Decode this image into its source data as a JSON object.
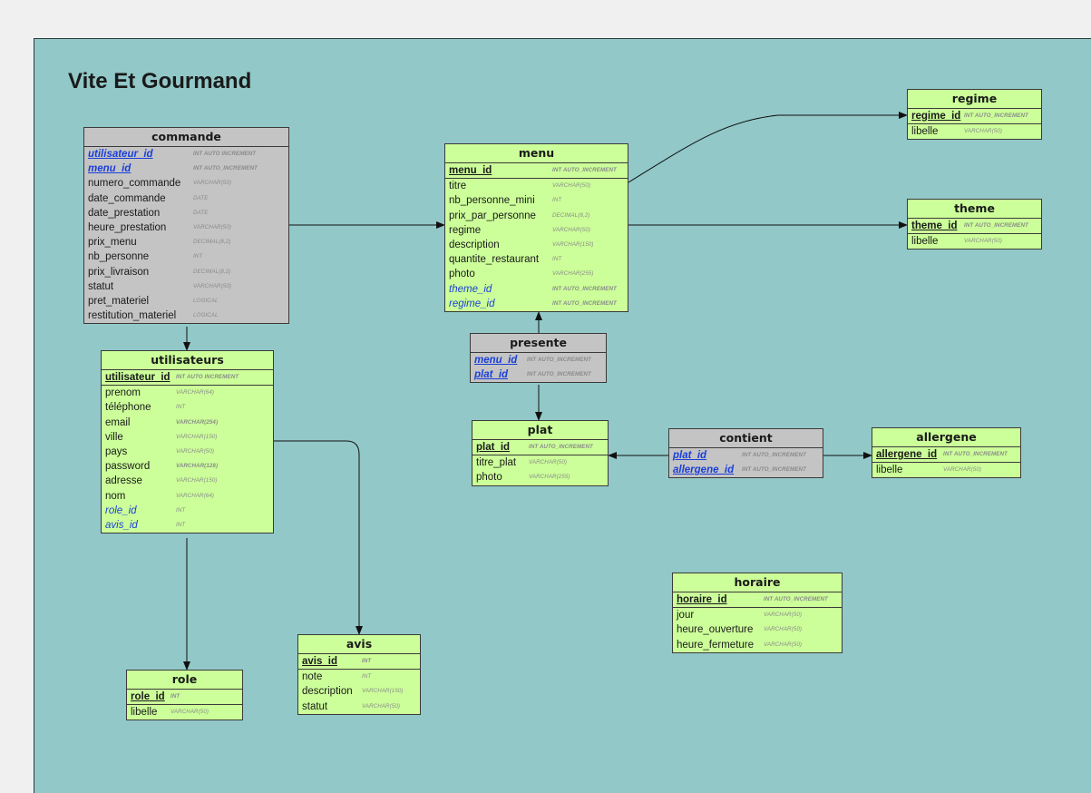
{
  "diagram": {
    "title": "Vite Et Gourmand",
    "colors": {
      "entity": "#ccff99",
      "association": "#c4c4c4",
      "background": "#92c8c8",
      "foreign_key": "#1a3fd9"
    },
    "entities": [
      {
        "id": "commande",
        "name": "commande",
        "style": "gray",
        "fields": [
          {
            "name": "utilisateur_id",
            "type": "INT AUTO INCREMENT",
            "key": "pkfk"
          },
          {
            "name": "menu_id",
            "type": "INT AUTO_INCREMENT",
            "key": "pkfk"
          },
          {
            "name": "numero_commande",
            "type": "VARCHAR(50)",
            "key": ""
          },
          {
            "name": "date_commande",
            "type": "DATE",
            "key": ""
          },
          {
            "name": "date_prestation",
            "type": "DATE",
            "key": ""
          },
          {
            "name": "heure_prestation",
            "type": "VARCHAR(50)",
            "key": ""
          },
          {
            "name": "prix_menu",
            "type": "DECIMAL(8,2)",
            "key": ""
          },
          {
            "name": "nb_personne",
            "type": "INT",
            "key": ""
          },
          {
            "name": "prix_livraison",
            "type": "DECIMAL(8,2)",
            "key": ""
          },
          {
            "name": "statut",
            "type": "VARCHAR(50)",
            "key": ""
          },
          {
            "name": "pret_materiel",
            "type": "LOGICAL",
            "key": ""
          },
          {
            "name": "restitution_materiel",
            "type": "LOGICAL",
            "key": ""
          }
        ]
      },
      {
        "id": "utilisateurs",
        "name": "utilisateurs",
        "style": "green",
        "fields": [
          {
            "name": "utilisateur_id",
            "type": "INT AUTO INCREMENT",
            "key": "pk"
          },
          {
            "name": "prenom",
            "type": "VARCHAR(64)",
            "key": ""
          },
          {
            "name": "téléphone",
            "type": "INT",
            "key": ""
          },
          {
            "name": "email",
            "type": "VARCHAR(254)",
            "key": "",
            "strong": true
          },
          {
            "name": "ville",
            "type": "VARCHAR(150)",
            "key": ""
          },
          {
            "name": "pays",
            "type": "VARCHAR(50)",
            "key": ""
          },
          {
            "name": "password",
            "type": "VARCHAR(128)",
            "key": "",
            "strong": true
          },
          {
            "name": "adresse",
            "type": "VARCHAR(150)",
            "key": ""
          },
          {
            "name": "nom",
            "type": "VARCHAR(64)",
            "key": ""
          },
          {
            "name": "role_id",
            "type": "INT",
            "key": "fk"
          },
          {
            "name": "avis_id",
            "type": "INT",
            "key": "fk"
          }
        ]
      },
      {
        "id": "menu",
        "name": "menu",
        "style": "green",
        "fields": [
          {
            "name": "menu_id",
            "type": "INT AUTO_INCREMENT",
            "key": "pk"
          },
          {
            "name": "titre",
            "type": "VARCHAR(50)",
            "key": ""
          },
          {
            "name": "nb_personne_mini",
            "type": "INT",
            "key": ""
          },
          {
            "name": "prix_par_personne",
            "type": "DECIMAL(8,2)",
            "key": ""
          },
          {
            "name": "regime",
            "type": "VARCHAR(50)",
            "key": ""
          },
          {
            "name": "description",
            "type": "VARCHAR(150)",
            "key": ""
          },
          {
            "name": "quantite_restaurant",
            "type": "INT",
            "key": ""
          },
          {
            "name": "photo",
            "type": "VARCHAR(255)",
            "key": ""
          },
          {
            "name": "theme_id",
            "type": "INT AUTO_INCREMENT",
            "key": "fk",
            "strong": true
          },
          {
            "name": "regime_id",
            "type": "INT AUTO_INCREMENT",
            "key": "fk",
            "strong": true
          }
        ]
      },
      {
        "id": "presente",
        "name": "presente",
        "style": "gray",
        "fields": [
          {
            "name": "menu_id",
            "type": "INT AUTO_INCREMENT",
            "key": "pkfk"
          },
          {
            "name": "plat_id",
            "type": "INT AUTO_INCREMENT",
            "key": "pkfk"
          }
        ]
      },
      {
        "id": "plat",
        "name": "plat",
        "style": "green",
        "fields": [
          {
            "name": "plat_id",
            "type": "INT AUTO_INCREMENT",
            "key": "pk"
          },
          {
            "name": "titre_plat",
            "type": "VARCHAR(50)",
            "key": ""
          },
          {
            "name": "photo",
            "type": "VARCHAR(255)",
            "key": ""
          }
        ]
      },
      {
        "id": "contient",
        "name": "contient",
        "style": "gray",
        "fields": [
          {
            "name": "plat_id",
            "type": "INT AUTO_INCREMENT",
            "key": "pkfk"
          },
          {
            "name": "allergene_id",
            "type": "INT AUTO_INCREMENT",
            "key": "pkfk"
          }
        ]
      },
      {
        "id": "allergene",
        "name": "allergene",
        "style": "green",
        "fields": [
          {
            "name": "allergene_id",
            "type": "INT AUTO_INCREMENT",
            "key": "pk"
          },
          {
            "name": "libelle",
            "type": "VARCHAR(50)",
            "key": ""
          }
        ]
      },
      {
        "id": "regime",
        "name": "regime",
        "style": "green",
        "fields": [
          {
            "name": "regime_id",
            "type": "INT AUTO_INCREMENT",
            "key": "pk"
          },
          {
            "name": "libelle",
            "type": "VARCHAR(50)",
            "key": ""
          }
        ]
      },
      {
        "id": "theme",
        "name": "theme",
        "style": "green",
        "fields": [
          {
            "name": "theme_id",
            "type": "INT AUTO_INCREMENT",
            "key": "pk"
          },
          {
            "name": "libelle",
            "type": "VARCHAR(50)",
            "key": ""
          }
        ]
      },
      {
        "id": "horaire",
        "name": "horaire",
        "style": "green",
        "fields": [
          {
            "name": "horaire_id",
            "type": "INT AUTO_INCREMENT",
            "key": "pk"
          },
          {
            "name": "jour",
            "type": "VARCHAR(50)",
            "key": ""
          },
          {
            "name": "heure_ouverture",
            "type": "VARCHAR(50)",
            "key": ""
          },
          {
            "name": "heure_fermeture",
            "type": "VARCHAR(50)",
            "key": ""
          }
        ]
      },
      {
        "id": "avis",
        "name": "avis",
        "style": "green",
        "fields": [
          {
            "name": "avis_id",
            "type": "INT",
            "key": "pk"
          },
          {
            "name": "note",
            "type": "INT",
            "key": ""
          },
          {
            "name": "description",
            "type": "VARCHAR(150)",
            "key": ""
          },
          {
            "name": "statut",
            "type": "VARCHAR(50)",
            "key": ""
          }
        ]
      },
      {
        "id": "role",
        "name": "role",
        "style": "green",
        "fields": [
          {
            "name": "role_id",
            "type": "INT",
            "key": "pk"
          },
          {
            "name": "libelle",
            "type": "VARCHAR(50)",
            "key": ""
          }
        ]
      }
    ],
    "relations": [
      {
        "from": "commande",
        "to": "menu"
      },
      {
        "from": "commande",
        "to": "utilisateurs"
      },
      {
        "from": "menu",
        "to": "regime"
      },
      {
        "from": "menu",
        "to": "theme"
      },
      {
        "from": "presente",
        "to": "menu"
      },
      {
        "from": "presente",
        "to": "plat"
      },
      {
        "from": "contient",
        "to": "plat"
      },
      {
        "from": "contient",
        "to": "allergene"
      },
      {
        "from": "utilisateurs",
        "to": "role"
      },
      {
        "from": "utilisateurs",
        "to": "avis"
      }
    ]
  }
}
